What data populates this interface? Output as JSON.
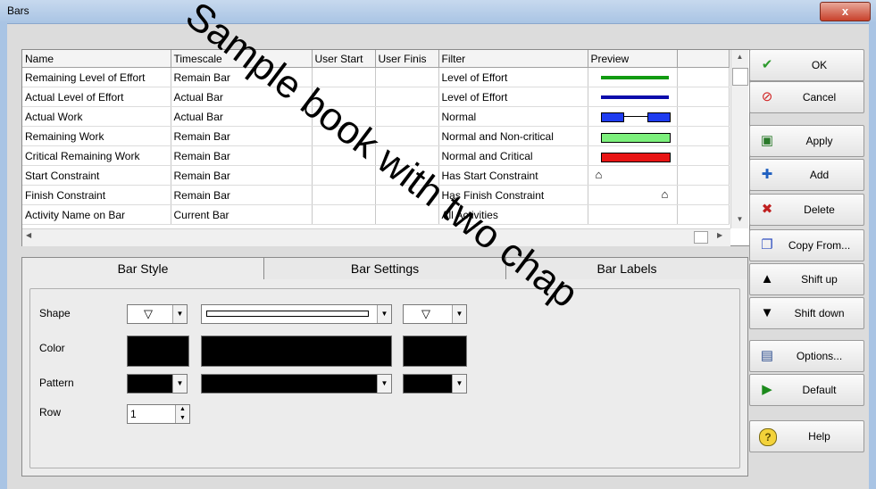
{
  "window": {
    "title": "Bars",
    "close_label": "x"
  },
  "table": {
    "columns": [
      "Name",
      "Timescale",
      "User Start",
      "User Finis",
      "Filter",
      "Preview"
    ],
    "rows": [
      {
        "name": "Remaining Level of Effort",
        "timescale": "Remain Bar",
        "filter": "Level of Effort",
        "preview": "green"
      },
      {
        "name": "Actual Level of Effort",
        "timescale": "Actual Bar",
        "filter": "Level of Effort",
        "preview": "blue"
      },
      {
        "name": "Actual Work",
        "timescale": "Actual Bar",
        "filter": "Normal",
        "preview": "blue-split"
      },
      {
        "name": "Remaining Work",
        "timescale": "Remain Bar",
        "filter": "Normal and Non-critical",
        "preview": "lightgreen"
      },
      {
        "name": "Critical Remaining Work",
        "timescale": "Remain Bar",
        "filter": "Normal and Critical",
        "preview": "red"
      },
      {
        "name": "Start Constraint",
        "timescale": "Remain Bar",
        "filter": "Has Start Constraint",
        "preview": "start-marker"
      },
      {
        "name": "Finish Constraint",
        "timescale": "Remain Bar",
        "filter": "Has Finish Constraint",
        "preview": "finish-marker"
      },
      {
        "name": "Activity Name on Bar",
        "timescale": "Current Bar",
        "filter": "All Activities",
        "preview": "none"
      }
    ],
    "preview_colors": {
      "green": "#119b11",
      "blue": "#0b0bab",
      "lightgreen": "#7cf07c",
      "red": "#e81414",
      "split": "#1e3cf0"
    },
    "marker_symbol": "⌂"
  },
  "tabs": [
    "Bar Style",
    "Bar Settings",
    "Bar Labels"
  ],
  "bar_style": {
    "shape_label": "Shape",
    "color_label": "Color",
    "pattern_label": "Pattern",
    "row_label": "Row",
    "start_shape": "▽",
    "end_shape": "▽",
    "row_value": "1"
  },
  "buttons": [
    {
      "label": "OK",
      "icon": "check-icon"
    },
    {
      "label": "Cancel",
      "icon": "cancel-icon"
    },
    {
      "label": "Apply",
      "icon": "apply-icon"
    },
    {
      "label": "Add",
      "icon": "add-icon"
    },
    {
      "label": "Delete",
      "icon": "delete-icon"
    },
    {
      "label": "Copy From...",
      "icon": "copy-icon"
    },
    {
      "label": "Shift up",
      "icon": "shift-up-icon"
    },
    {
      "label": "Shift down",
      "icon": "shift-down-icon"
    },
    {
      "label": "Options...",
      "icon": "options-icon"
    },
    {
      "label": "Default",
      "icon": "default-icon"
    },
    {
      "label": "Help",
      "icon": "help-icon"
    }
  ],
  "watermark": "Sample book with two chap"
}
